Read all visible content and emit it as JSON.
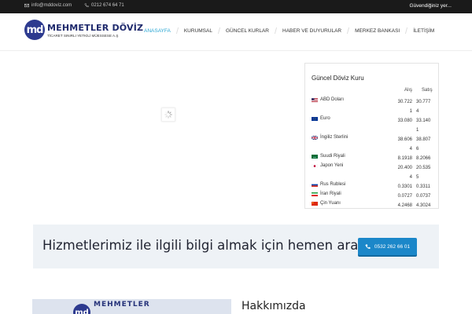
{
  "topbar": {
    "email": "info@mddoviz.com",
    "phone": "0212 674 64 71",
    "tagline": "Güvendiğiniz yer..."
  },
  "logo": {
    "mark": "md",
    "name": "MEHMETLER DÖVİZ",
    "subtitle": "TİCARET SINIRLI YETKİLİ MÜESSESE A.Ş"
  },
  "nav": [
    {
      "label": "ANASAYFA",
      "active": true
    },
    {
      "label": "KURUMSAL",
      "active": false
    },
    {
      "label": "GÜNCEL KURLAR",
      "active": false
    },
    {
      "label": "HABER VE DUYURULAR",
      "active": false
    },
    {
      "label": "MERKEZ BANKASI",
      "active": false
    },
    {
      "label": "İLETİŞİM",
      "active": false
    }
  ],
  "rates": {
    "title": "Güncel Döviz Kuru",
    "buy_header": "Alış",
    "sell_header": "Satış",
    "rows": [
      {
        "flag": "us-flag-icon",
        "name": "ABD Doları",
        "buy": "30.7221",
        "sell": "30.7774"
      },
      {
        "flag": "eu-flag-icon",
        "name": "Euro",
        "buy": "33.080",
        "sell": "33.1401"
      },
      {
        "flag": "gb-flag-icon",
        "name": "İngiliz Sterlini",
        "buy": "38.6064",
        "sell": "38.8076"
      },
      {
        "flag": "sa-flag-icon",
        "name": "Suudi Riyali",
        "buy": "8.1918",
        "sell": "8.2066"
      },
      {
        "flag": "jp-flag-icon",
        "name": "Japon Yeni",
        "buy": "20.4004",
        "sell": "20.5355"
      },
      {
        "flag": "ru-flag-icon",
        "name": "Rus Rublesi",
        "buy": "0.3301",
        "sell": "0.3311"
      },
      {
        "flag": "ir-flag-icon",
        "name": "İran Riyali",
        "buy": "0.0727",
        "sell": "0.0737"
      },
      {
        "flag": "cn-flag-icon",
        "name": "Çin Yuanı",
        "buy": "4.2468",
        "sell": "4.3024"
      }
    ]
  },
  "cta": {
    "text": "Hizmetlerimiz ile ilgili bilgi almak için hemen arayın!",
    "phone": "0532 262 66 01"
  },
  "about": {
    "title": "Hakkımızda",
    "image_mark": "md",
    "image_name": "MEHMETLER"
  },
  "colors": {
    "accent": "#2aa6d3",
    "brand_navy": "#2d3a8f",
    "button_blue": "#1b87c9",
    "topbar_bg": "#1a1a1a",
    "cta_bg": "#eef2f6"
  }
}
